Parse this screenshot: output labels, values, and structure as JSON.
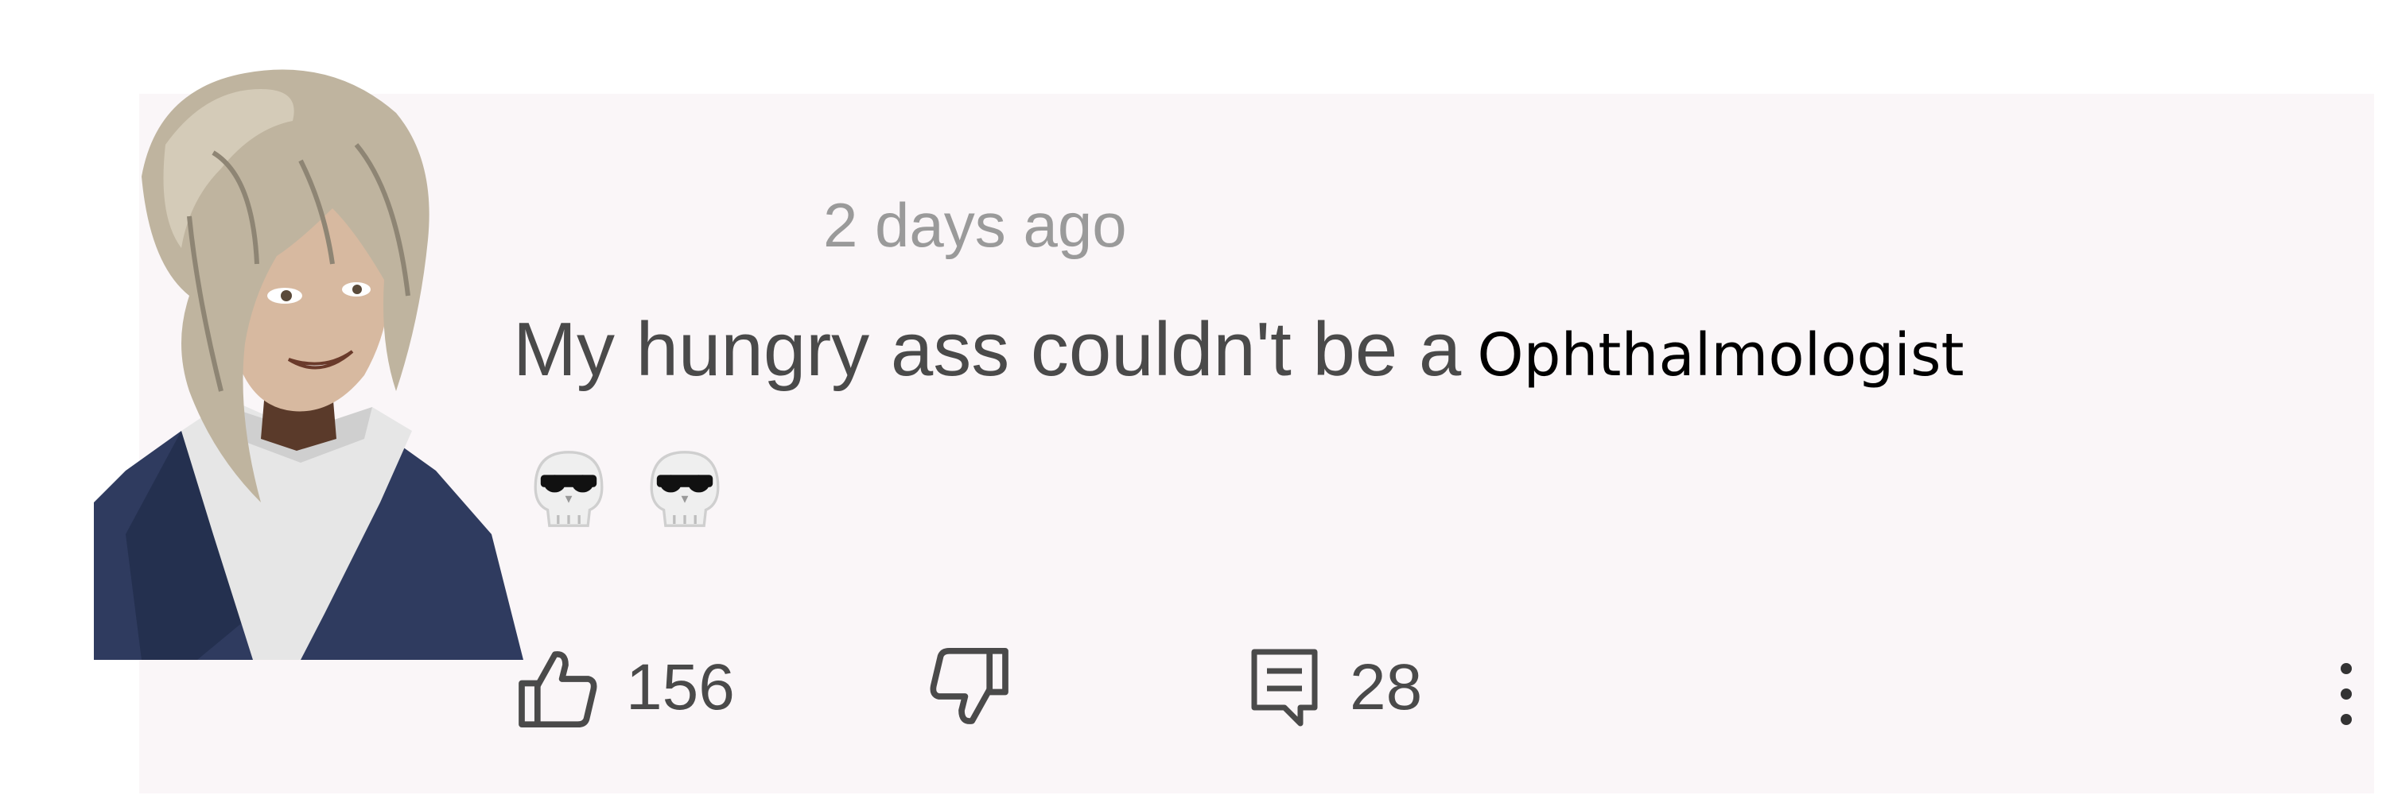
{
  "comment": {
    "timestamp": "2 days ago",
    "text_main": "My hungry ass couldn't be a",
    "text_overlay": "Ophthalmologist",
    "emojis": [
      "skull",
      "skull"
    ]
  },
  "actions": {
    "like_count": "156",
    "reply_count": "28"
  },
  "icons": {
    "like": "thumbs-up-icon",
    "dislike": "thumbs-down-icon",
    "reply": "reply-icon",
    "more": "more-vertical-icon"
  },
  "colors": {
    "card_bg": "#faf6f8",
    "text_gray": "#4a4a4a",
    "timestamp_gray": "#9a9a9a"
  }
}
